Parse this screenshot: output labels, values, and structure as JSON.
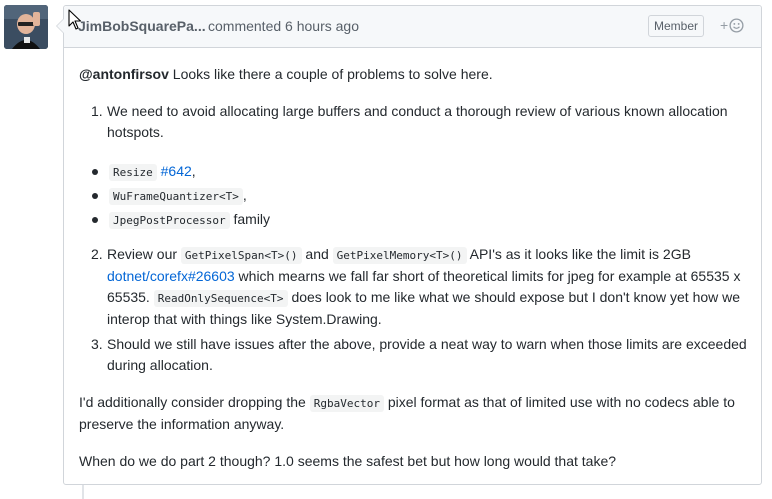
{
  "comment": {
    "author": "JimBobSquarePa...",
    "action": "commented 6 hours ago",
    "badge": "Member",
    "reaction_plus": "+",
    "mention": "@antonfirsov",
    "intro": "Looks like there a couple of problems to solve here.",
    "item1_num": "1.",
    "item1_text": "We need to avoid allocating large buffers and conduct a thorough review of various known allocation hotspots.",
    "bullets": [
      {
        "code": "Resize",
        "link": "#642",
        "suffix": ","
      },
      {
        "code": "WuFrameQuantizer<T>",
        "suffix": ","
      },
      {
        "code": "JpegPostProcessor",
        "suffix": "family"
      }
    ],
    "item2_num": "2.",
    "item2_a": "Review our",
    "item2_code1": "GetPixelSpan<T>()",
    "item2_and": "and",
    "item2_code2": "GetPixelMemory<T>()",
    "item2_b": "API's as it looks like the limit is 2GB",
    "item2_link": "dotnet/corefx#26603",
    "item2_c": "which mearns we fall far short of theoretical limits for jpeg for example at 65535 x 65535.",
    "item2_code3": "ReadOnlySequence<T>",
    "item2_d": "does look to me like what we should expose but I don't know yet how we interop that with things like System.Drawing.",
    "item3_num": "3.",
    "item3_text": "Should we still have issues after the above, provide a neat way to warn when those limits are exceeded during allocation.",
    "para2_a": "I'd additionally consider dropping the",
    "para2_code": "RgbaVector",
    "para2_b": "pixel format as that of limited use with no codecs able to preserve the information anyway.",
    "para3": "When do we do part 2 though? 1.0 seems the safest bet but how long would that take?"
  }
}
